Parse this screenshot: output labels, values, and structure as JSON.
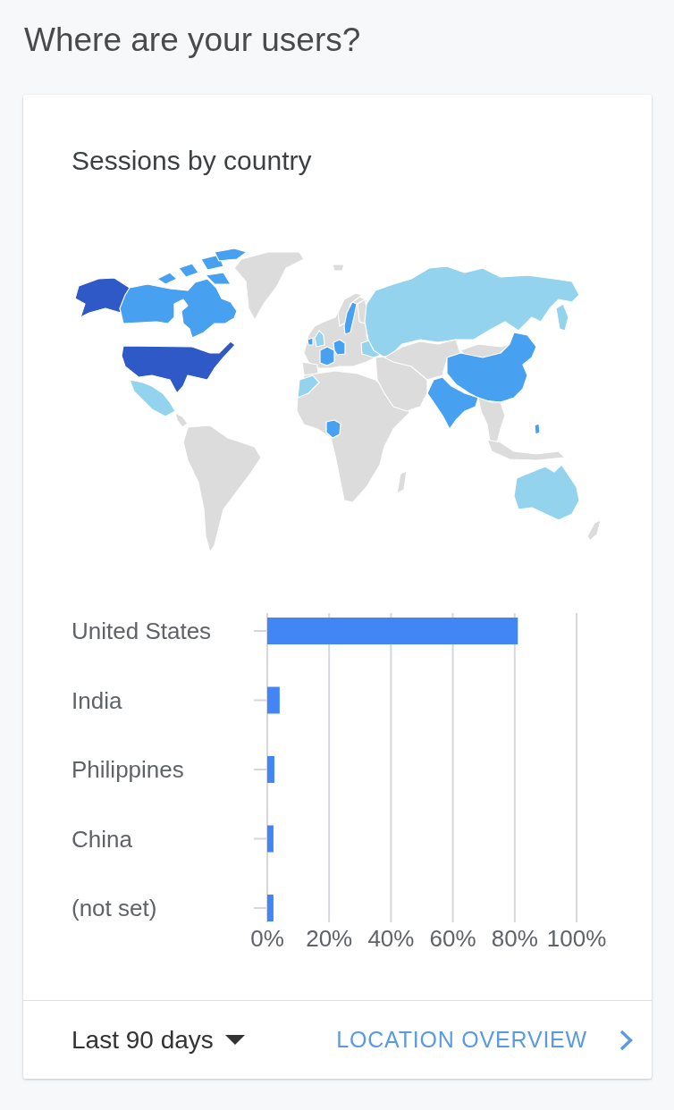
{
  "section": {
    "title": "Where are your users?"
  },
  "card": {
    "title": "Sessions by country",
    "chart": {
      "chart_data": {
        "type": "bar",
        "orientation": "horizontal",
        "grid": true,
        "categories": [
          "United States",
          "India",
          "Philippines",
          "China",
          "(not set)"
        ],
        "values": [
          81,
          4,
          2.3,
          2,
          2
        ],
        "xlim": [
          0,
          100
        ],
        "xticks": [
          {
            "value": 0,
            "label": "0%"
          },
          {
            "value": 20,
            "label": "20%"
          },
          {
            "value": 40,
            "label": "40%"
          },
          {
            "value": 60,
            "label": "60%"
          },
          {
            "value": 80,
            "label": "80%"
          },
          {
            "value": 100,
            "label": "100%"
          }
        ]
      }
    },
    "footer": {
      "date_range": {
        "label": "Last 90 days"
      },
      "link": {
        "label": "LOCATION OVERVIEW"
      }
    }
  }
}
